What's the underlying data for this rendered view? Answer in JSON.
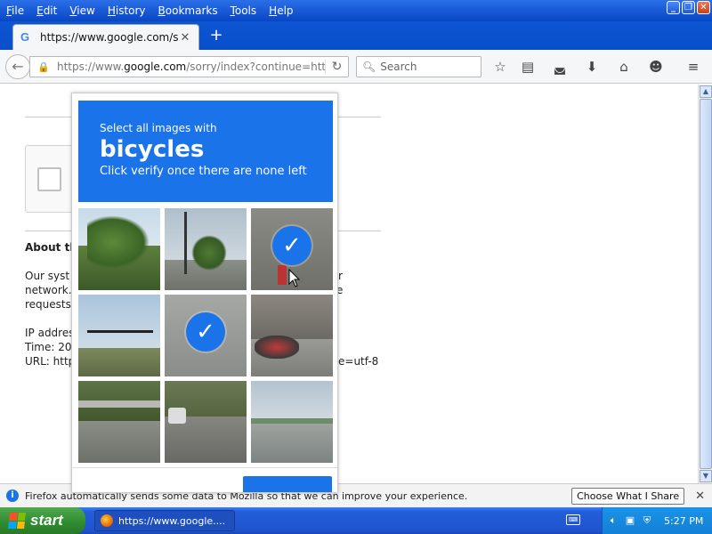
{
  "menu": {
    "items": [
      {
        "label": "File",
        "key": "F",
        "rest": "ile"
      },
      {
        "label": "Edit",
        "key": "E",
        "rest": "dit"
      },
      {
        "label": "View",
        "key": "V",
        "rest": "iew"
      },
      {
        "label": "History",
        "key": "H",
        "rest": "istory"
      },
      {
        "label": "Bookmarks",
        "key": "B",
        "rest": "ookmarks"
      },
      {
        "label": "Tools",
        "key": "T",
        "rest": "ools"
      },
      {
        "label": "Help",
        "key": "H",
        "rest": "elp"
      }
    ]
  },
  "tab": {
    "title": "https://www.google.com/sea...",
    "favicon_letter": "G"
  },
  "navbar": {
    "url_prefix": "https://www.",
    "url_domain": "google.com",
    "url_rest": "/sorry/index?continue=https:/",
    "search_placeholder": "Search"
  },
  "page": {
    "about_heading": "About th",
    "line1_start": "Our syst",
    "line1_end": "r",
    "line2_start": "network.",
    "line2_end": "e",
    "line3_start": "requests",
    "ip_label": "IP addres",
    "time_label": "Time: 20",
    "url_label": "URL: http",
    "url_end": "e=utf-8"
  },
  "captcha": {
    "prompt": "Select all images with",
    "target": "bicycles",
    "instruction": "Click verify once there are none left",
    "tiles_selected": [
      false,
      false,
      true,
      false,
      true,
      false,
      false,
      false,
      false
    ],
    "accent_color": "#1a73e8"
  },
  "notification": {
    "message": "Firefox automatically sends some data to Mozilla so that we can improve your experience.",
    "button_label": "Choose What I Share"
  },
  "taskbar": {
    "start_label": "start",
    "task_label": "https://www.google....",
    "clock": "5:27 PM"
  }
}
